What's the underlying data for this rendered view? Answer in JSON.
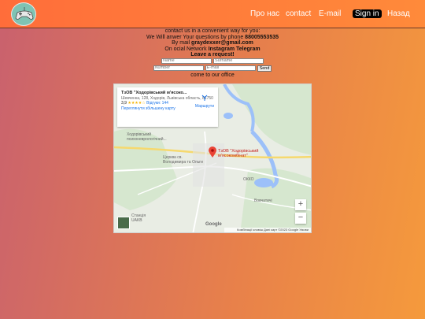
{
  "nav": {
    "about": "Про нас",
    "contact": "contact",
    "email": "E-mail",
    "signin": "Sign in",
    "back": "Назад"
  },
  "contact": {
    "line1": "contact us in a convenient way for you:",
    "line2_prefix": "We Will anwer Your questions by phone ",
    "phone": "88005553535",
    "line3_prefix": "By mail ",
    "mail": "graydexxer@gmail.com",
    "line4_prefix": "On ocial Network ",
    "instagram": "Instagram",
    "telegram": "Telegram",
    "request_title": "Leave a request!",
    "come": "come to our office"
  },
  "form": {
    "name_placeholder": "Name",
    "surname_placeholder": "Surname",
    "number_placeholder": "Number",
    "email_placeholder": "E-mail",
    "send_label": "Send"
  },
  "map": {
    "place_title": "ТзОВ \"Ходорівський м'ясоко...",
    "address": "Шевченка, 128, Ходорів, Львівська область, 81750",
    "rating": "3,9",
    "stars": "★★★★☆",
    "reviews": "Відгуки: 144",
    "bigger_map": "Переглянути збільшену карту",
    "route_label": "Маршрути",
    "pin_label_1": "ТзОВ \"Ходорівський",
    "pin_label_2": "м'ясокомбінат\"",
    "poi1": "Ходорівський",
    "poi2": "психоневрологічний...",
    "poi3": "Церква св.",
    "poi4": "Володимира та Ольги",
    "poi5": "ОККО",
    "poi6": "Вовчатичі",
    "poi7": "Станція",
    "poi8": "UAKB",
    "google": "Google",
    "footer": "Комбінації клавіш   Дані карт ©2023 Google   Умови",
    "zoom_in": "+",
    "zoom_out": "−"
  },
  "colors": {
    "topbar": "#ff7a3a",
    "logo_bg": "#7fc3b3",
    "accent_link": "#1a73e8",
    "pin": "#ea4335"
  }
}
